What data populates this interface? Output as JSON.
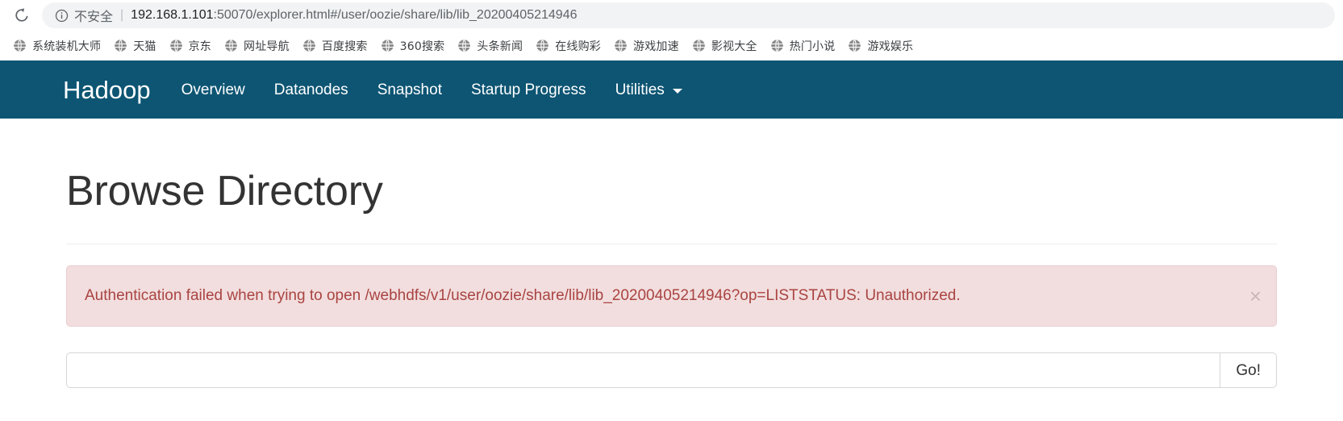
{
  "browser": {
    "reload_icon": "reload-icon",
    "security_icon": "info-circle-icon",
    "security_label": "不安全",
    "url_separator": "|",
    "url_host": "192.168.1.101",
    "url_rest": ":50070/explorer.html#/user/oozie/share/lib/lib_20200405214946",
    "url_full": "192.168.1.101:50070/explorer.html#/user/oozie/share/lib/lib_20200405214946",
    "bookmarks": [
      {
        "label": "系统装机大师",
        "icon": "globe-icon"
      },
      {
        "label": "天猫",
        "icon": "globe-icon"
      },
      {
        "label": "京东",
        "icon": "globe-icon"
      },
      {
        "label": "网址导航",
        "icon": "globe-icon"
      },
      {
        "label": "百度搜索",
        "icon": "globe-icon"
      },
      {
        "label": "360搜索",
        "icon": "globe-icon"
      },
      {
        "label": "头条新闻",
        "icon": "globe-icon"
      },
      {
        "label": "在线购彩",
        "icon": "globe-icon"
      },
      {
        "label": "游戏加速",
        "icon": "globe-icon"
      },
      {
        "label": "影视大全",
        "icon": "globe-icon"
      },
      {
        "label": "热门小说",
        "icon": "globe-icon"
      },
      {
        "label": "游戏娱乐",
        "icon": "globe-icon"
      }
    ]
  },
  "navbar": {
    "brand": "Hadoop",
    "background_color": "#0d5573",
    "items": [
      {
        "label": "Overview"
      },
      {
        "label": "Datanodes"
      },
      {
        "label": "Snapshot"
      },
      {
        "label": "Startup Progress"
      },
      {
        "label": "Utilities",
        "has_caret": true
      }
    ]
  },
  "main": {
    "title": "Browse Directory",
    "alert": {
      "message": "Authentication failed when trying to open /webhdfs/v1/user/oozie/share/lib/lib_20200405214946?op=LISTSTATUS: Unauthorized.",
      "close_label": "×",
      "background_color": "#f2dede",
      "border_color": "#ebccd1",
      "text_color": "#a94442"
    },
    "path_form": {
      "input_value": "",
      "input_placeholder": "",
      "go_label": "Go!"
    }
  }
}
